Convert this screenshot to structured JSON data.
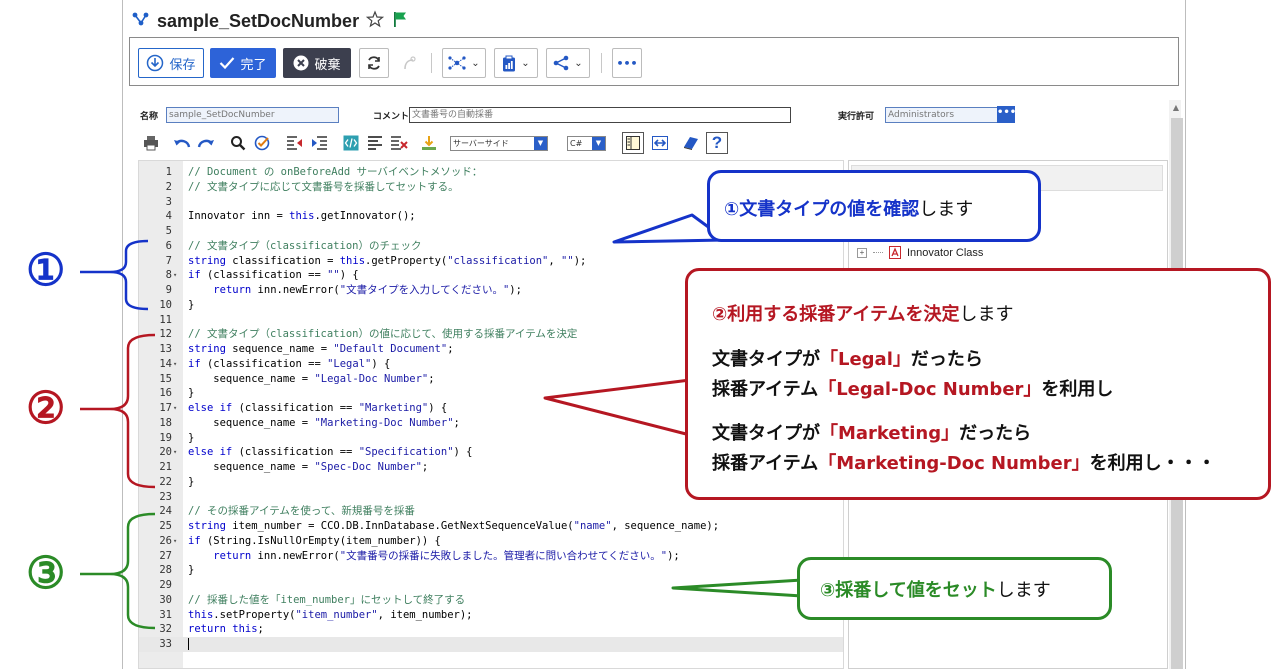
{
  "window": {
    "title": "sample_SetDocNumber"
  },
  "toolbar": {
    "save_label": "保存",
    "done_label": "完了",
    "discard_label": "破棄",
    "menu_dots": "•••"
  },
  "form": {
    "name_label": "名称",
    "name_value": "sample_SetDocNumber",
    "comment_label": "コメント",
    "comment_value": "文書番号の自動採番",
    "permission_label": "実行許可",
    "permission_value": "Administrators",
    "permission_btn": "•••"
  },
  "editor_toolbar": {
    "location_value": "サーバーサイド",
    "language_value": "C#"
  },
  "right_panel": {
    "tree_item": "Innovator Class"
  },
  "code": {
    "lines": [
      [
        {
          "t": "// Document の onBeforeAdd サーバイベントメソッド：",
          "c": "cm"
        }
      ],
      [
        {
          "t": "// 文書タイプに応じて文書番号を採番してセットする。",
          "c": "cm"
        }
      ],
      [],
      [
        {
          "t": "Innovator inn = ",
          "c": "tx"
        },
        {
          "t": "this",
          "c": "kw"
        },
        {
          "t": ".getInnovator();",
          "c": "tx"
        }
      ],
      [],
      [
        {
          "t": "// 文書タイプ（classification）のチェック",
          "c": "cm"
        }
      ],
      [
        {
          "t": "string",
          "c": "kw"
        },
        {
          "t": " classification = ",
          "c": "tx"
        },
        {
          "t": "this",
          "c": "kw"
        },
        {
          "t": ".getProperty(",
          "c": "tx"
        },
        {
          "t": "\"classification\"",
          "c": "st"
        },
        {
          "t": ", ",
          "c": "tx"
        },
        {
          "t": "\"\"",
          "c": "st"
        },
        {
          "t": ");",
          "c": "tx"
        }
      ],
      [
        {
          "t": "if",
          "c": "kw"
        },
        {
          "t": " (classification == ",
          "c": "tx"
        },
        {
          "t": "\"\"",
          "c": "st"
        },
        {
          "t": ") {",
          "c": "tx"
        }
      ],
      [
        {
          "t": "    ",
          "c": "tx"
        },
        {
          "t": "return",
          "c": "kw"
        },
        {
          "t": " inn.newError(",
          "c": "tx"
        },
        {
          "t": "\"文書タイプを入力してください。\"",
          "c": "st"
        },
        {
          "t": ");",
          "c": "tx"
        }
      ],
      [
        {
          "t": "}",
          "c": "tx"
        }
      ],
      [],
      [
        {
          "t": "// 文書タイプ（classification）の値に応じて、使用する採番アイテムを決定",
          "c": "cm"
        }
      ],
      [
        {
          "t": "string",
          "c": "kw"
        },
        {
          "t": " sequence_name = ",
          "c": "tx"
        },
        {
          "t": "\"Default Document\"",
          "c": "st"
        },
        {
          "t": ";",
          "c": "tx"
        }
      ],
      [
        {
          "t": "if",
          "c": "kw"
        },
        {
          "t": " (classification == ",
          "c": "tx"
        },
        {
          "t": "\"Legal\"",
          "c": "st"
        },
        {
          "t": ") {",
          "c": "tx"
        }
      ],
      [
        {
          "t": "    sequence_name = ",
          "c": "tx"
        },
        {
          "t": "\"Legal-Doc Number\"",
          "c": "st"
        },
        {
          "t": ";",
          "c": "tx"
        }
      ],
      [
        {
          "t": "}",
          "c": "tx"
        }
      ],
      [
        {
          "t": "else if",
          "c": "kw"
        },
        {
          "t": " (classification == ",
          "c": "tx"
        },
        {
          "t": "\"Marketing\"",
          "c": "st"
        },
        {
          "t": ") {",
          "c": "tx"
        }
      ],
      [
        {
          "t": "    sequence_name = ",
          "c": "tx"
        },
        {
          "t": "\"Marketing-Doc Number\"",
          "c": "st"
        },
        {
          "t": ";",
          "c": "tx"
        }
      ],
      [
        {
          "t": "}",
          "c": "tx"
        }
      ],
      [
        {
          "t": "else if",
          "c": "kw"
        },
        {
          "t": " (classification == ",
          "c": "tx"
        },
        {
          "t": "\"Specification\"",
          "c": "st"
        },
        {
          "t": ") {",
          "c": "tx"
        }
      ],
      [
        {
          "t": "    sequence_name = ",
          "c": "tx"
        },
        {
          "t": "\"Spec-Doc Number\"",
          "c": "st"
        },
        {
          "t": ";",
          "c": "tx"
        }
      ],
      [
        {
          "t": "}",
          "c": "tx"
        }
      ],
      [],
      [
        {
          "t": "// その採番アイテムを使って、新規番号を採番",
          "c": "cm"
        }
      ],
      [
        {
          "t": "string",
          "c": "kw"
        },
        {
          "t": " item_number = CCO.DB.InnDatabase.GetNextSequenceValue(",
          "c": "tx"
        },
        {
          "t": "\"name\"",
          "c": "st"
        },
        {
          "t": ", sequence_name);",
          "c": "tx"
        }
      ],
      [
        {
          "t": "if",
          "c": "kw"
        },
        {
          "t": " (String.IsNullOrEmpty(item_number)) {",
          "c": "tx"
        }
      ],
      [
        {
          "t": "    ",
          "c": "tx"
        },
        {
          "t": "return",
          "c": "kw"
        },
        {
          "t": " inn.newError(",
          "c": "tx"
        },
        {
          "t": "\"文書番号の採番に失敗しました。管理者に問い合わせてください。\"",
          "c": "st"
        },
        {
          "t": ");",
          "c": "tx"
        }
      ],
      [
        {
          "t": "}",
          "c": "tx"
        }
      ],
      [],
      [
        {
          "t": "// 採番した値を「item_number」にセットして終了する",
          "c": "cm"
        }
      ],
      [
        {
          "t": "this",
          "c": "kw"
        },
        {
          "t": ".setProperty(",
          "c": "tx"
        },
        {
          "t": "\"item_number\"",
          "c": "st"
        },
        {
          "t": ", item_number);",
          "c": "tx"
        }
      ],
      [
        {
          "t": "return this",
          "c": "kw"
        },
        {
          "t": ";",
          "c": "tx"
        }
      ],
      []
    ],
    "fold_lines": [
      8,
      14,
      17,
      20,
      26
    ]
  },
  "annotations": {
    "markers": {
      "one": "①",
      "two": "②",
      "three": "③"
    },
    "callout1": {
      "highlight": "①文書タイプの値を確認",
      "rest": "します"
    },
    "callout2": {
      "head_highlight": "②利用する採番アイテムを決定",
      "head_rest": "します",
      "l1_a": "文書タイプが",
      "l1_b": "「Legal」",
      "l1_c": "だったら",
      "l2_a": "採番アイテム",
      "l2_b": "「Legal-Doc Number」",
      "l2_c": "を利用し",
      "l3_a": "文書タイプが",
      "l3_b": "「Marketing」",
      "l3_c": "だったら",
      "l4_a": "採番アイテム",
      "l4_b": "「Marketing-Doc Number」",
      "l4_c": "を利用し・・・"
    },
    "callout3": {
      "highlight": "③採番して値をセット",
      "rest": "します"
    },
    "colors": {
      "blue": "#1533c9",
      "red": "#b51722",
      "green": "#2b8b27"
    }
  }
}
